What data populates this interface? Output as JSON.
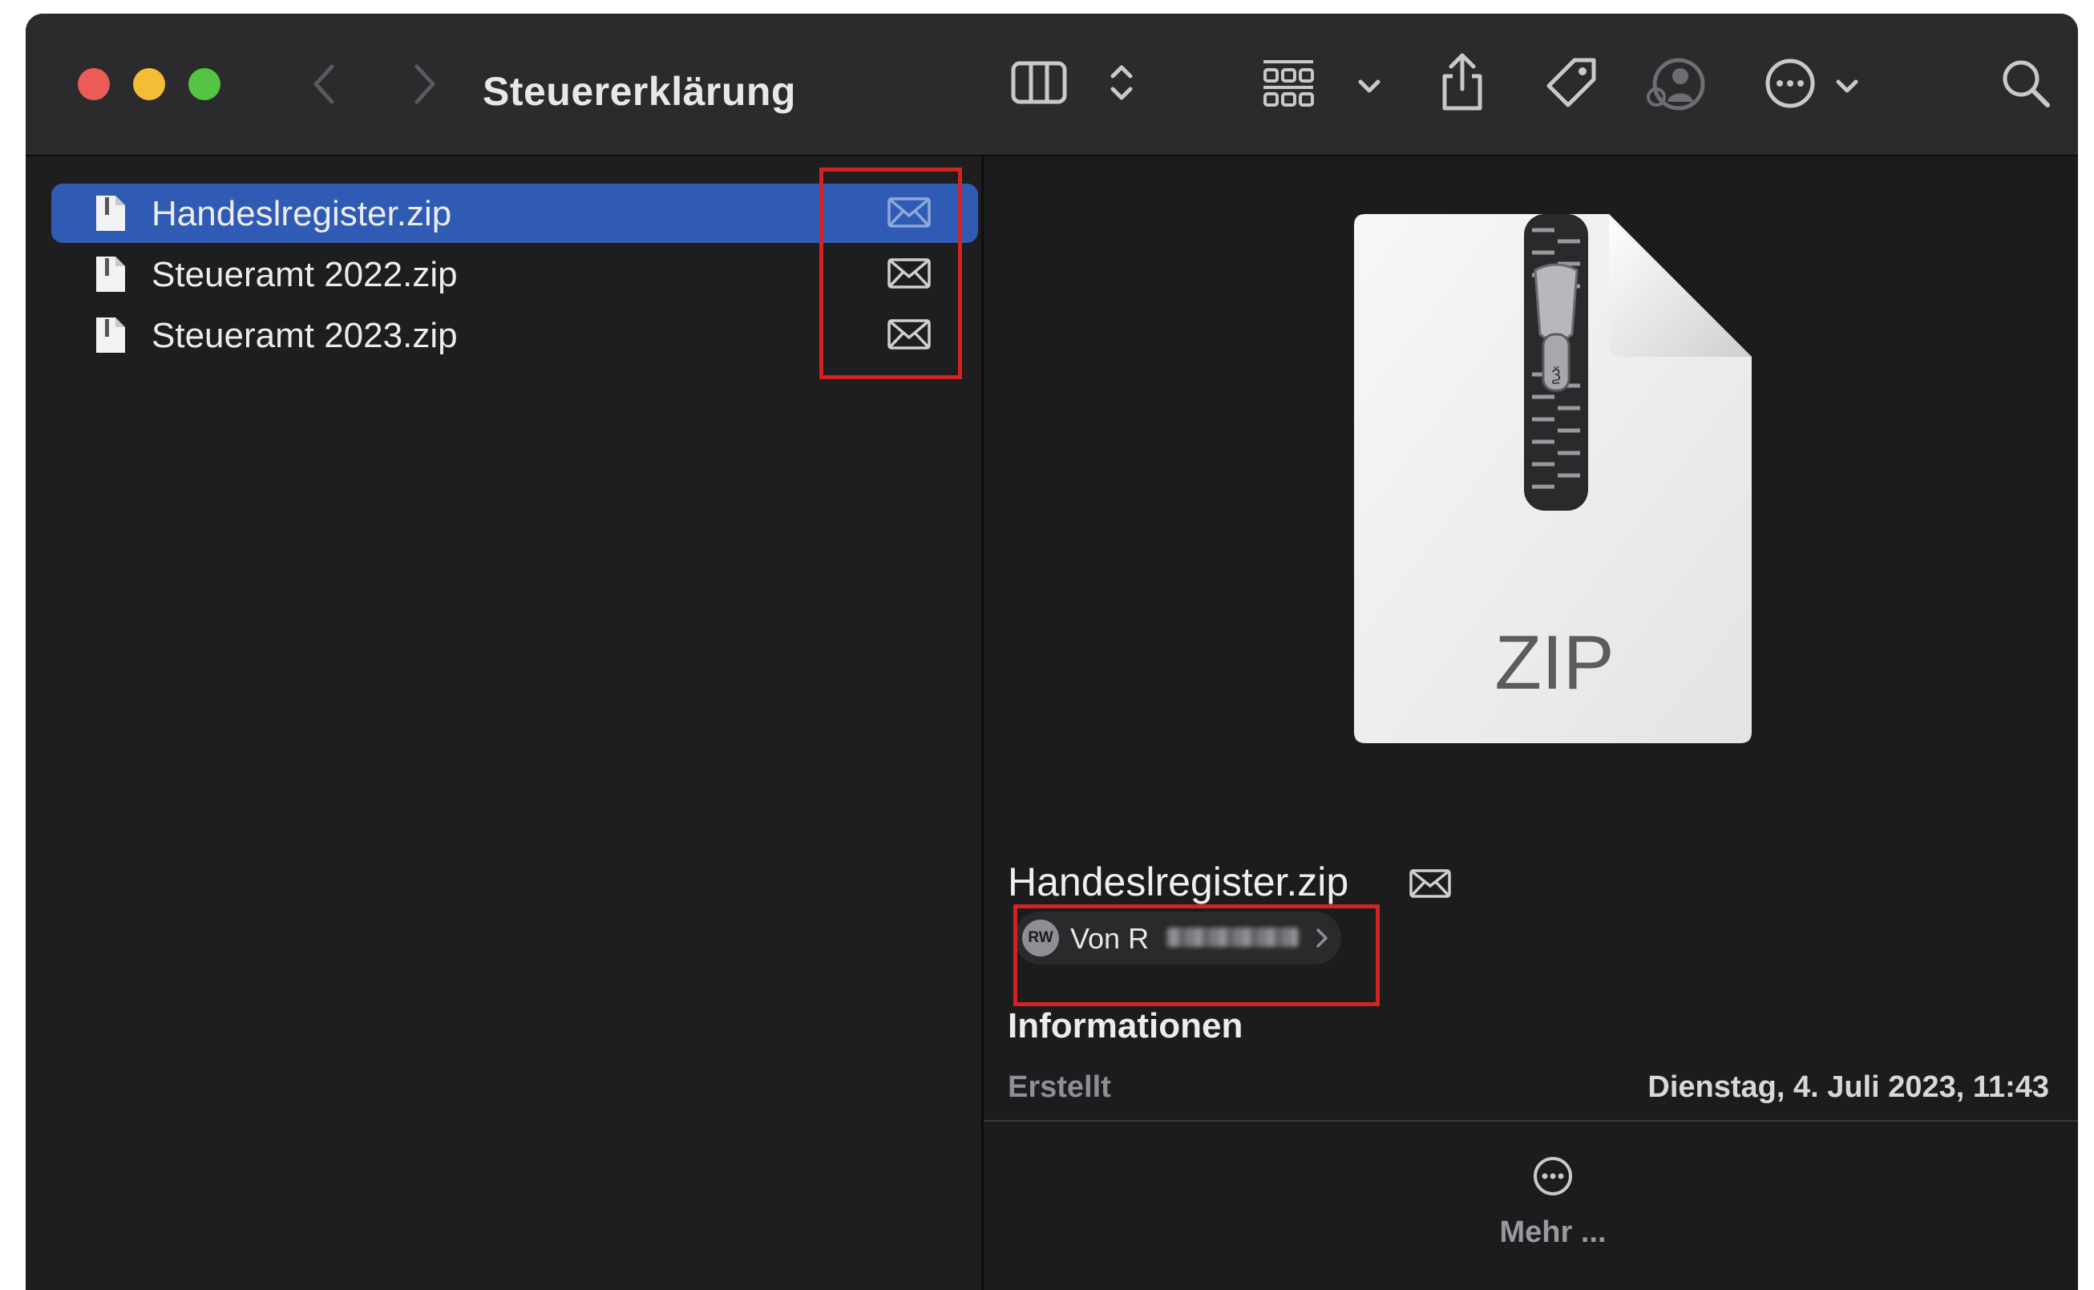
{
  "window": {
    "title": "Steuererklärung"
  },
  "toolbar": {
    "icons": [
      "back-chevron-icon",
      "forward-chevron-icon",
      "column-view-icon",
      "updown-chevron-icon",
      "group-grid-icon",
      "chevron-down-icon",
      "share-icon",
      "tag-icon",
      "shared-user-icon",
      "more-circle-icon",
      "chevron-down-icon",
      "search-icon"
    ]
  },
  "files": [
    {
      "name": "Handeslregister.zip",
      "selected": true,
      "icon": "zip-file-icon",
      "badge": "mail-icon"
    },
    {
      "name": "Steueramt 2022.zip",
      "selected": false,
      "icon": "zip-file-icon",
      "badge": "mail-icon"
    },
    {
      "name": "Steueramt 2023.zip",
      "selected": false,
      "icon": "zip-file-icon",
      "badge": "mail-icon"
    }
  ],
  "preview": {
    "thumbnail_label": "ZIP",
    "file_name": "Handeslregister.zip",
    "from": {
      "avatar_initials": "RW",
      "label": "Von R"
    },
    "section_title": "Informationen",
    "meta": {
      "key": "Erstellt",
      "value": "Dienstag, 4. Juli 2023, 11:43"
    },
    "more_label": "Mehr ..."
  },
  "colors": {
    "selection": "#2f5bb5",
    "highlight_box": "#d42222",
    "close": "#ed5b56",
    "minimize": "#f5bd35",
    "zoom": "#55c443"
  }
}
